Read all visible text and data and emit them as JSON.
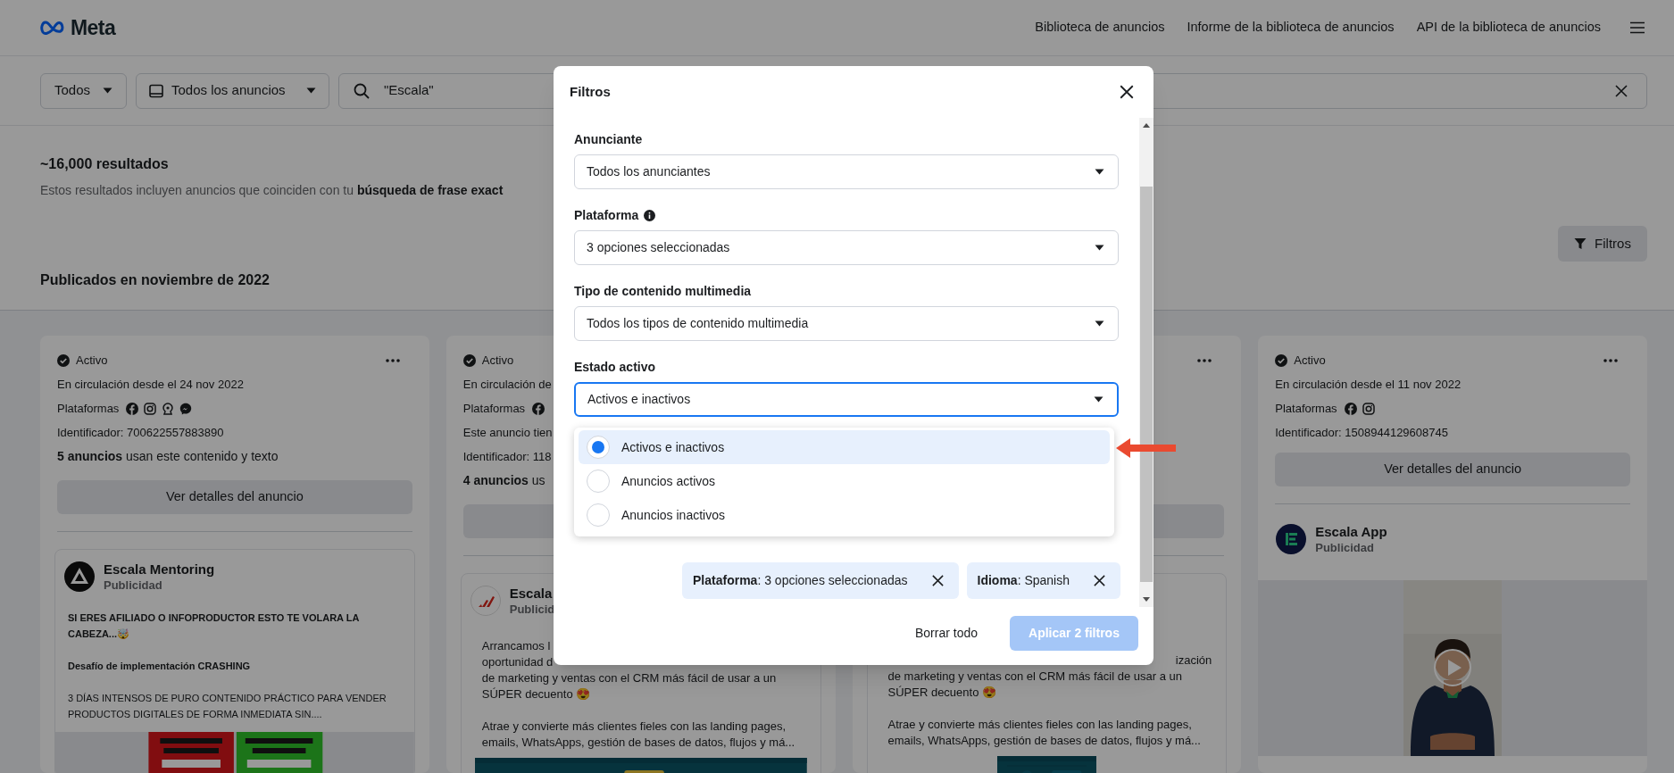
{
  "header": {
    "logo": "Meta",
    "nav": [
      "Biblioteca de anuncios",
      "Informe de la biblioteca de anuncios",
      "API de la biblioteca de anuncios"
    ]
  },
  "search_bar": {
    "country": "Todos",
    "ad_category": "Todos los anuncios",
    "query": "\"Escala\""
  },
  "results": {
    "count": "~16,000 resultados",
    "description": "Estos resultados incluyen anuncios que coinciden con tu **búsqueda de frase exact**",
    "filters_button": "Filtros",
    "section_title": "Publicados en noviembre de 2022"
  },
  "cards": [
    {
      "kind": "full",
      "status": "Activo",
      "since": "En circulación desde el 24 nov 2022",
      "platforms_label": "Plataformas",
      "platforms": [
        {
          "kind": "facebook"
        },
        {
          "kind": "instagram"
        },
        {
          "kind": "network"
        },
        {
          "kind": "messenger"
        }
      ],
      "id": "Identificador: 700622557883890",
      "usage": "**5 anuncios** usan este contenido y texto",
      "details_button": "Ver detalles del anuncio",
      "ad": {
        "advertiser": "Escala Mentoring",
        "sponsored": "Publicidad",
        "paragraphs": [
          {
            "text": "SI ERES AFILIADO O INFOPRODUCTOR ESTO TE VOLARA LA CABEZA...🤯",
            "bold": true
          },
          {
            "text": "Desafío de implementación CRASHING",
            "bold": true
          },
          {
            "text": "3 DÍAS INTENSOS DE PURO CONTENIDO PRÁCTICO PARA VENDER PRODUCTOS DIGITALES DE FORMA INMEDIATA SIN....",
            "bold": false
          }
        ]
      }
    },
    {
      "kind": "cut-right",
      "status": "Activo",
      "since": "En circulación de",
      "platforms_label": "Plataformas",
      "platforms": [
        {
          "kind": "facebook"
        }
      ],
      "note": "Este anuncio tien",
      "id": "Identificador: 118",
      "usage": "**4 anuncios** us",
      "ad": {
        "advertiser": "Escala",
        "sponsored": "Publicid",
        "paragraphs": [
          {
            "lines": [
              "Arrancamos l",
              "oportunidad d",
              "de marketing y ventas con el CRM más fácil de usar a un",
              "SÚPER decuento 😍"
            ]
          },
          {
            "lines": [
              "Atrae y convierte más clientes fieles con las landing pages,",
              "emails, WhatsApps, gestión de bases de datos, flujos y má..."
            ]
          }
        ]
      }
    },
    {
      "kind": "cut-left",
      "ad": {
        "paragraphs": [
          {
            "lines": [
              "ización",
              "de marketing y ventas con el CRM más fácil de usar a un",
              "SÚPER decuento 😍"
            ]
          },
          {
            "lines": [
              "Atrae y convierte más clientes fieles con las landing pages,",
              "emails, WhatsApps, gestión de bases de datos, flujos y má..."
            ]
          }
        ]
      }
    },
    {
      "kind": "video",
      "status": "Activo",
      "since": "En circulación desde el 11 nov 2022",
      "platforms_label": "Plataformas",
      "platforms": [
        {
          "kind": "facebook"
        },
        {
          "kind": "instagram"
        }
      ],
      "id": "Identificador: 1508944129608745",
      "details_button": "Ver detalles del anuncio",
      "ad": {
        "advertiser": "Escala App",
        "sponsored": "Publicidad"
      }
    }
  ],
  "modal": {
    "title": "Filtros",
    "fields": [
      {
        "label": "Anunciante",
        "value": "Todos los anunciantes",
        "info": false,
        "focused": false
      },
      {
        "label": "Plataforma",
        "value": "3 opciones seleccionadas",
        "info": true,
        "focused": false
      },
      {
        "label": "Tipo de contenido multimedia",
        "value": "Todos los tipos de contenido multimedia",
        "info": false,
        "focused": false
      },
      {
        "label": "Estado activo",
        "value": "Activos e inactivos",
        "info": false,
        "focused": true
      }
    ],
    "dropdown": {
      "options": [
        {
          "label": "Activos e inactivos",
          "selected": true
        },
        {
          "label": "Anuncios activos",
          "selected": false
        },
        {
          "label": "Anuncios inactivos",
          "selected": false
        }
      ]
    },
    "chips": [
      {
        "text": "**Plataforma**: 3 opciones seleccionadas"
      },
      {
        "text": "**Idioma**: Spanish"
      }
    ],
    "clear_button": "Borrar todo",
    "apply_button": {
      "label": "Aplicar 2 filtros",
      "disabled": true
    }
  }
}
